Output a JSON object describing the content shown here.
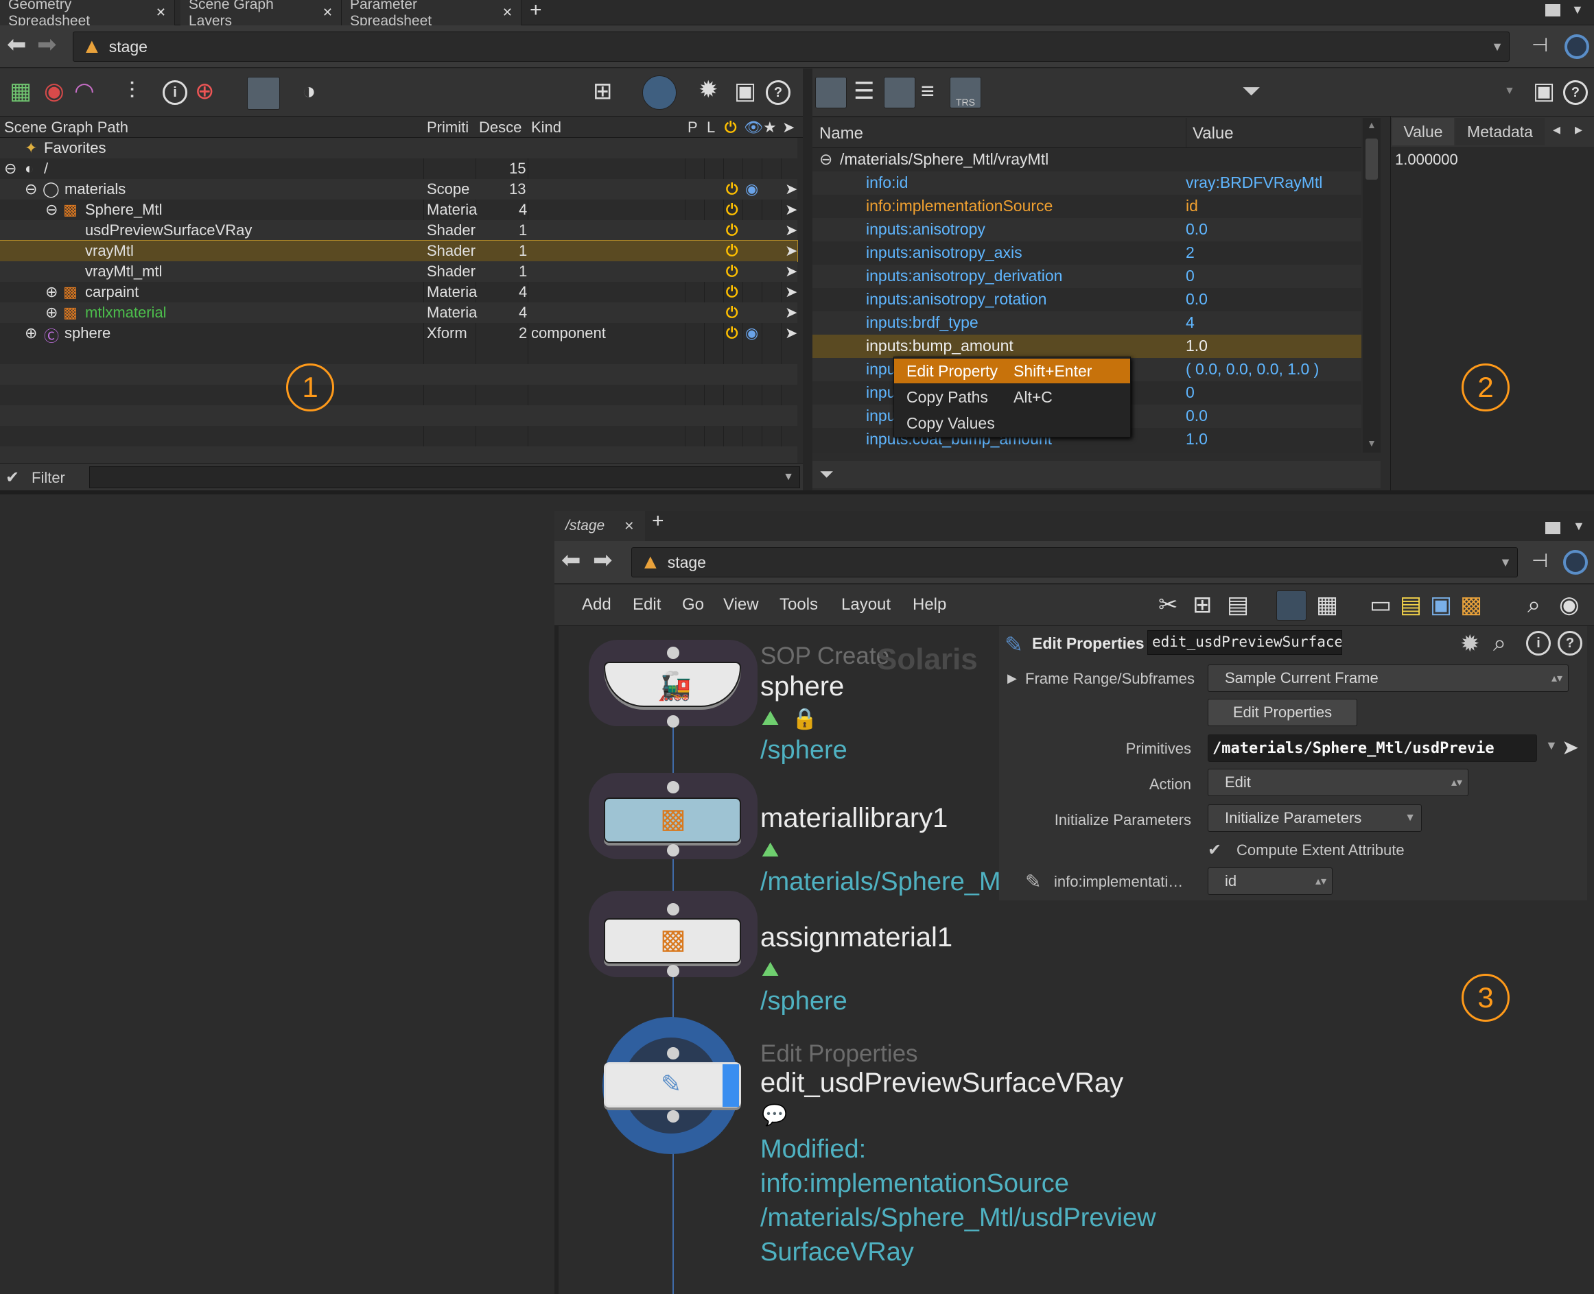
{
  "top_tabs": [
    "Geometry Spreadsheet",
    "Scene Graph Layers",
    "Parameter Spreadsheet"
  ],
  "path_bar": {
    "location": "stage"
  },
  "scene_graph": {
    "columns": [
      "Scene Graph Path",
      "Primiti",
      "Desce",
      "Kind",
      "P",
      "L"
    ],
    "favorites": "Favorites",
    "rows": [
      {
        "path": "/",
        "type": "",
        "desc": "15",
        "kind": ""
      },
      {
        "path": "materials",
        "type": "Scope",
        "desc": "13",
        "kind": ""
      },
      {
        "path": "Sphere_Mtl",
        "type": "Materia",
        "desc": "4",
        "kind": ""
      },
      {
        "path": "usdPreviewSurfaceVRay",
        "type": "Shader",
        "desc": "1",
        "kind": ""
      },
      {
        "path": "vrayMtl",
        "type": "Shader",
        "desc": "1",
        "kind": ""
      },
      {
        "path": "vrayMtl_mtl",
        "type": "Shader",
        "desc": "1",
        "kind": ""
      },
      {
        "path": "carpaint",
        "type": "Materia",
        "desc": "4",
        "kind": ""
      },
      {
        "path": "mtlxmaterial",
        "type": "Materia",
        "desc": "4",
        "kind": ""
      },
      {
        "path": "sphere",
        "type": "Xform",
        "desc": "2",
        "kind": "component"
      }
    ],
    "filter_label": "Filter",
    "selected_row": "vrayMtl"
  },
  "properties": {
    "col_name": "Name",
    "col_value": "Value",
    "root_path": "/materials/Sphere_Mtl/vrayMtl",
    "rows": [
      {
        "name": "info:id",
        "value": "vray:BRDFVRayMtl"
      },
      {
        "name": "info:implementationSource",
        "value": "id"
      },
      {
        "name": "inputs:anisotropy",
        "value": "0.0"
      },
      {
        "name": "inputs:anisotropy_axis",
        "value": "2"
      },
      {
        "name": "inputs:anisotropy_derivation",
        "value": "0"
      },
      {
        "name": "inputs:anisotropy_rotation",
        "value": "0.0"
      },
      {
        "name": "inputs:brdf_type",
        "value": "4"
      },
      {
        "name": "inputs:bump_amount",
        "value": "1.0"
      },
      {
        "name": "inpu",
        "value": "( 0.0, 0.0, 0.0, 1.0 )"
      },
      {
        "name": "inpu",
        "value": "0"
      },
      {
        "name": "inpu",
        "value": "0.0"
      },
      {
        "name": "inputs:coat_bump_amount",
        "value": "1.0"
      }
    ],
    "context_menu": [
      {
        "label": "Edit Property",
        "shortcut": "Shift+Enter"
      },
      {
        "label": "Copy Paths",
        "shortcut": "Alt+C"
      },
      {
        "label": "Copy Values",
        "shortcut": ""
      }
    ],
    "value_tabs": [
      "Value",
      "Metadata"
    ],
    "value_display": "1.000000"
  },
  "markers": [
    "1",
    "2",
    "3"
  ],
  "network": {
    "tab": "/stage",
    "path": "stage",
    "menu": [
      "Add",
      "Edit",
      "Go",
      "View",
      "Tools",
      "Layout",
      "Help"
    ],
    "context_watermark": "Solaris",
    "nodes": [
      {
        "type": "SOP Create",
        "name": "sphere",
        "path": "/sphere"
      },
      {
        "type": "",
        "name": "materiallibrary1",
        "path": "/materials/Sphere_M"
      },
      {
        "type": "",
        "name": "assignmaterial1",
        "path": "/sphere"
      },
      {
        "type": "Edit Properties",
        "name": "edit_usdPreviewSurfaceVRay",
        "path": ""
      }
    ],
    "modified_lines": [
      "Modified:",
      "info:implementationSource",
      "/materials/Sphere_Mtl/usdPreview",
      "SurfaceVRay"
    ]
  },
  "param_panel": {
    "title": "Edit Properties",
    "node_name": "edit_usdPreviewSurfaceVRay",
    "frame_range_label": "Frame Range/Subframes",
    "frame_range_value": "Sample Current Frame",
    "edit_button": "Edit Properties",
    "primitives_label": "Primitives",
    "primitives_value": "/materials/Sphere_Mtl/usdPrevie",
    "action_label": "Action",
    "action_value": "Edit",
    "init_label": "Initialize Parameters",
    "init_value": "Initialize Parameters",
    "compute_extent": "Compute Extent Attribute",
    "impl_label": "info:implementati…",
    "impl_value": "id"
  },
  "colors": {
    "accent": "#c7720b",
    "highlight_row": "#5a4a22",
    "param_text": "#5fb6ff",
    "node_path": "#4fb2c2",
    "marker": "#ff9a1a"
  }
}
